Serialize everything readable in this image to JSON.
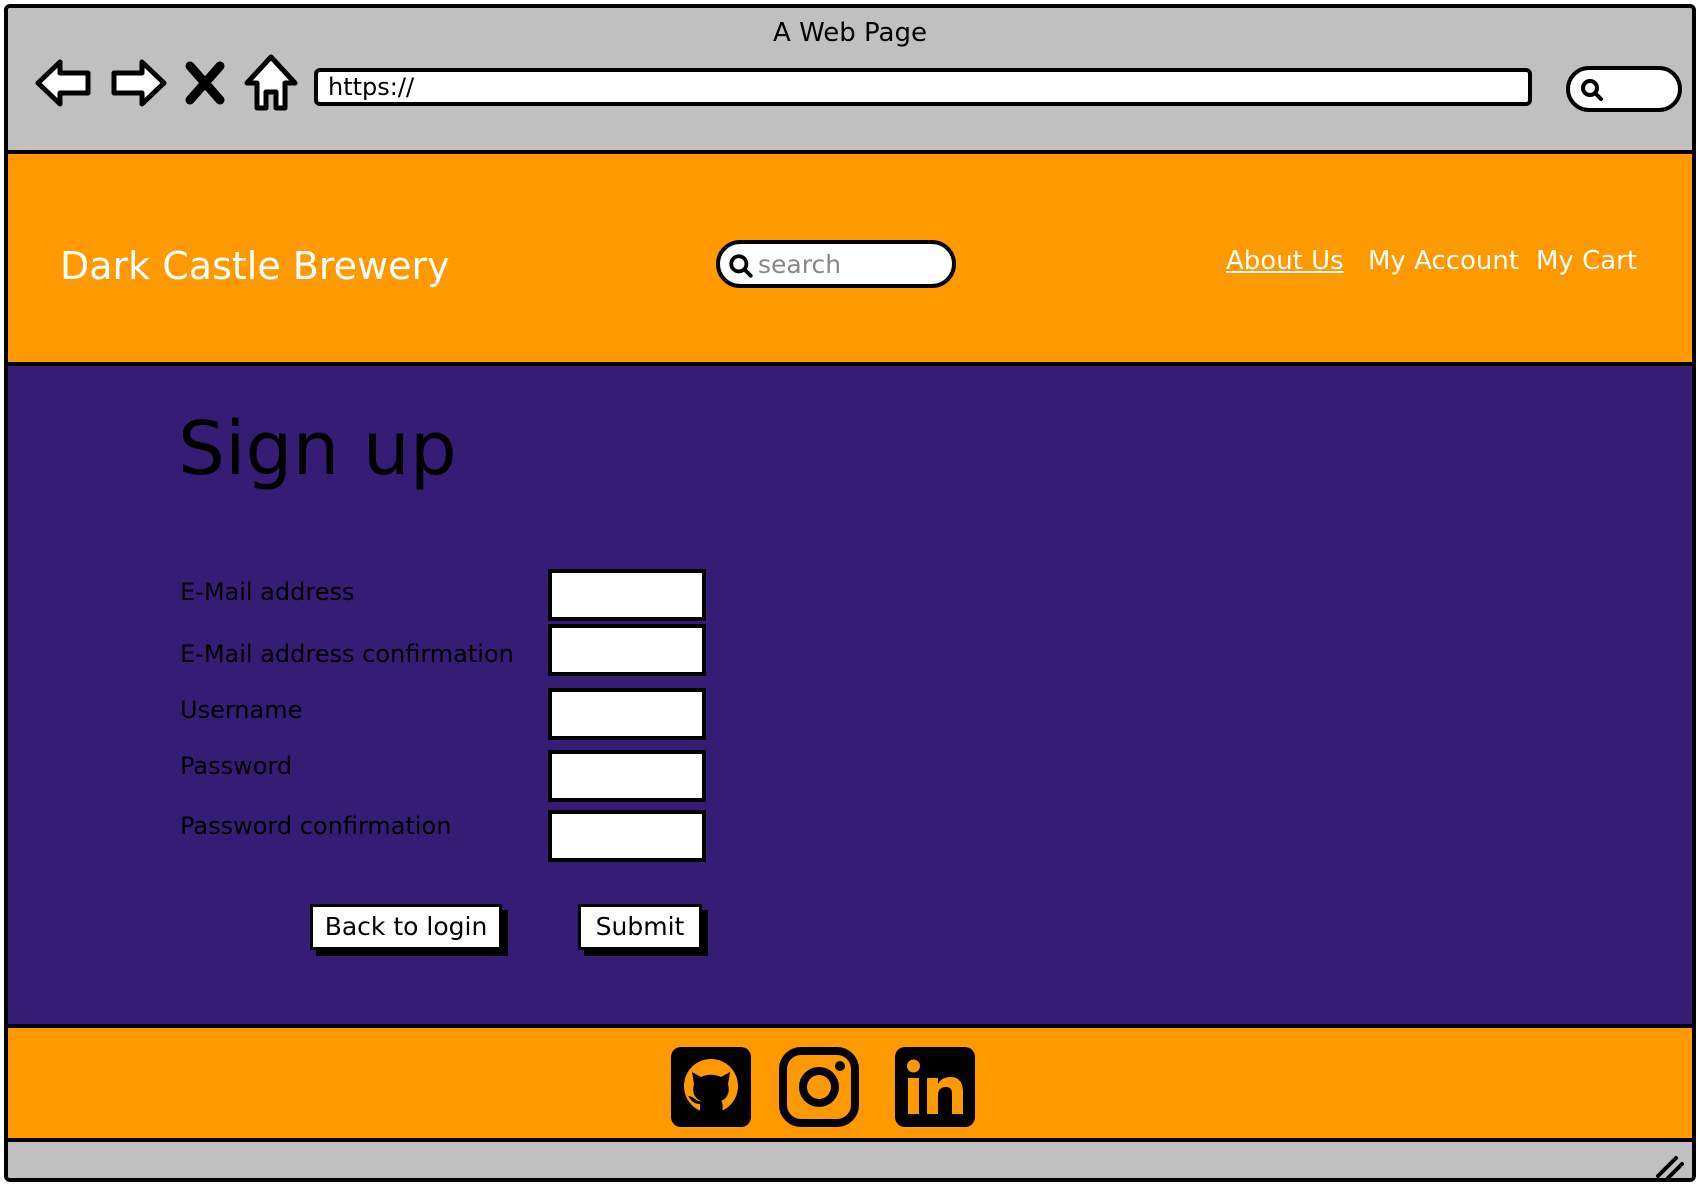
{
  "browser": {
    "window_title": "A Web Page",
    "url": "https://",
    "icons": [
      "back-arrow-icon",
      "forward-arrow-icon",
      "close-x-icon",
      "home-icon",
      "search-icon"
    ]
  },
  "header": {
    "brand": "Dark Castle Brewery",
    "search_placeholder": "search",
    "nav": [
      {
        "label": "About Us",
        "active": true
      },
      {
        "label": "My Account",
        "active": false
      },
      {
        "label": "My Cart",
        "active": false
      }
    ],
    "background_color": "#fe9900"
  },
  "main": {
    "title": "Sign up",
    "background_color": "#351c75",
    "fields": [
      {
        "label": "E-Mail address",
        "value": ""
      },
      {
        "label": "E-Mail address confirmation",
        "value": ""
      },
      {
        "label": "Username",
        "value": ""
      },
      {
        "label": "Password",
        "value": ""
      },
      {
        "label": "Password confirmation",
        "value": ""
      }
    ],
    "buttons": {
      "back": "Back to login",
      "submit": "Submit"
    }
  },
  "footer": {
    "social_icons": [
      "github-icon",
      "instagram-icon",
      "linkedin-icon"
    ]
  }
}
